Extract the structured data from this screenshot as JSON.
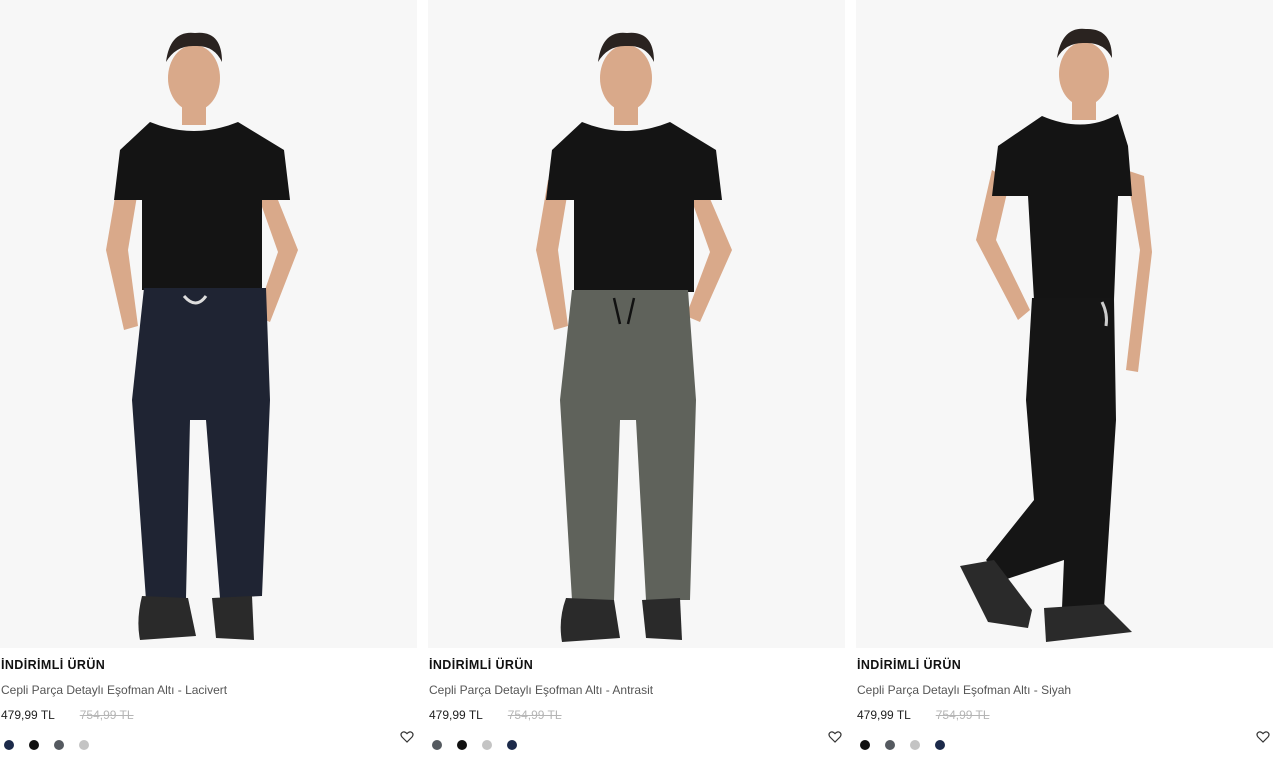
{
  "products": [
    {
      "badge": "İNDİRİMLİ ÜRÜN",
      "title": "Cepli Parça Detaylı Eşofman Altı - Lacivert",
      "price": "479,99 TL",
      "old_price": "754,99 TL",
      "pants_color": "#1f2433",
      "swatches": [
        "#1c2a4a",
        "#111111",
        "#555a60",
        "#c4c4c4"
      ]
    },
    {
      "badge": "İNDİRİMLİ ÜRÜN",
      "title": "Cepli Parça Detaylı Eşofman Altı - Antrasit",
      "price": "479,99 TL",
      "old_price": "754,99 TL",
      "pants_color": "#5f625b",
      "swatches": [
        "#555a60",
        "#111111",
        "#c4c4c4",
        "#1c2a4a"
      ]
    },
    {
      "badge": "İNDİRİMLİ ÜRÜN",
      "title": "Cepli Parça Detaylı Eşofman Altı - Siyah",
      "price": "479,99 TL",
      "old_price": "754,99 TL",
      "pants_color": "#151515",
      "swatches": [
        "#111111",
        "#555a60",
        "#c4c4c4",
        "#1c2a4a"
      ]
    }
  ],
  "icons": {
    "favorite": "heart-outline-icon"
  },
  "colors": {
    "badge": "#111111",
    "title": "#555555",
    "old_price": "#b5b5b5",
    "shirt": "#141414",
    "skin": "#d9a98a",
    "hair": "#2a2320",
    "shoe": "#2a2a2a"
  }
}
